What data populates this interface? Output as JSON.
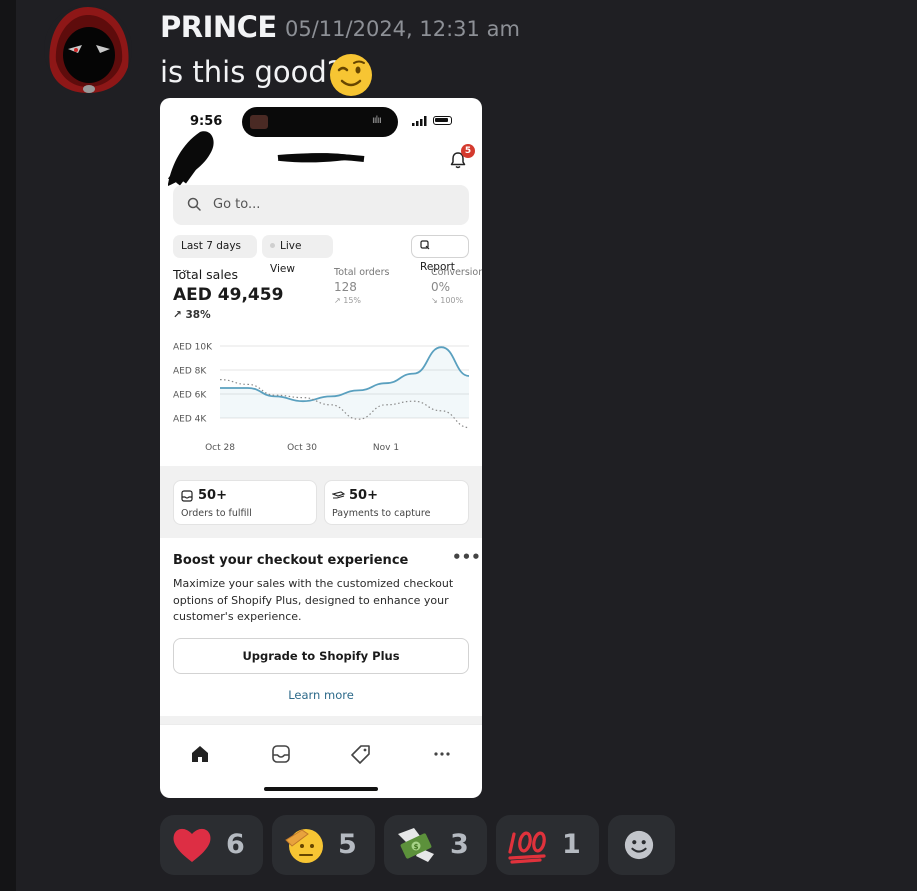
{
  "message": {
    "username": "PRINCE",
    "timestamp": "05/11/2024, 12:31 am",
    "text": "is this good?",
    "text_emoji": "winking-face"
  },
  "phone": {
    "status_time": "9:56",
    "notification_count": "5",
    "search_placeholder": "Go to...",
    "filters": {
      "range": "Last 7 days",
      "live": "Live View",
      "report": "Report"
    },
    "metrics": {
      "total_sales_label": "Total sales",
      "total_sales_value": "AED 49,459",
      "total_sales_delta": "38%",
      "orders_label": "Total orders",
      "orders_value": "128",
      "orders_delta": "15%",
      "conversion_label": "Conversion",
      "conversion_value": "0%",
      "conversion_delta": "100%"
    },
    "chart_data": {
      "type": "line",
      "y_tick_labels": [
        "AED 10K",
        "AED 8K",
        "AED 6K",
        "AED 4K"
      ],
      "x_tick_labels": [
        "Oct 28",
        "Oct 30",
        "Nov 1"
      ],
      "ylim": [
        4000,
        10000
      ],
      "series": [
        {
          "style": "solid",
          "color": "#5aa0bf",
          "values": [
            6.5,
            6.5,
            5.8,
            5.4,
            5.8,
            6.3,
            6.9,
            7.7,
            9.9,
            7.5
          ]
        },
        {
          "style": "dotted",
          "color": "#8a8a8a",
          "values": [
            7.2,
            6.8,
            5.9,
            5.7,
            5.1,
            3.9,
            5.1,
            5.4,
            4.6,
            3.2
          ]
        }
      ]
    },
    "cards": [
      {
        "count": "50+",
        "label": "Orders to fulfill"
      },
      {
        "count": "50+",
        "label": "Payments to capture"
      }
    ],
    "promo": {
      "title": "Boost your checkout experience",
      "more": "•••",
      "body": "Maximize your sales with the customized checkout options of Shopify Plus, designed to enhance your customer's experience.",
      "button": "Upgrade to Shopify Plus",
      "link": "Learn more"
    },
    "tabs": [
      "home-icon",
      "orders-icon",
      "products-icon",
      "more-icon"
    ]
  },
  "reactions": [
    {
      "emoji": "red-heart",
      "count": "6"
    },
    {
      "emoji": "saluting-face",
      "count": "5"
    },
    {
      "emoji": "money-with-wings",
      "count": "3"
    },
    {
      "emoji": "hundred-points",
      "count": "1"
    },
    {
      "emoji": "add-reaction"
    }
  ]
}
